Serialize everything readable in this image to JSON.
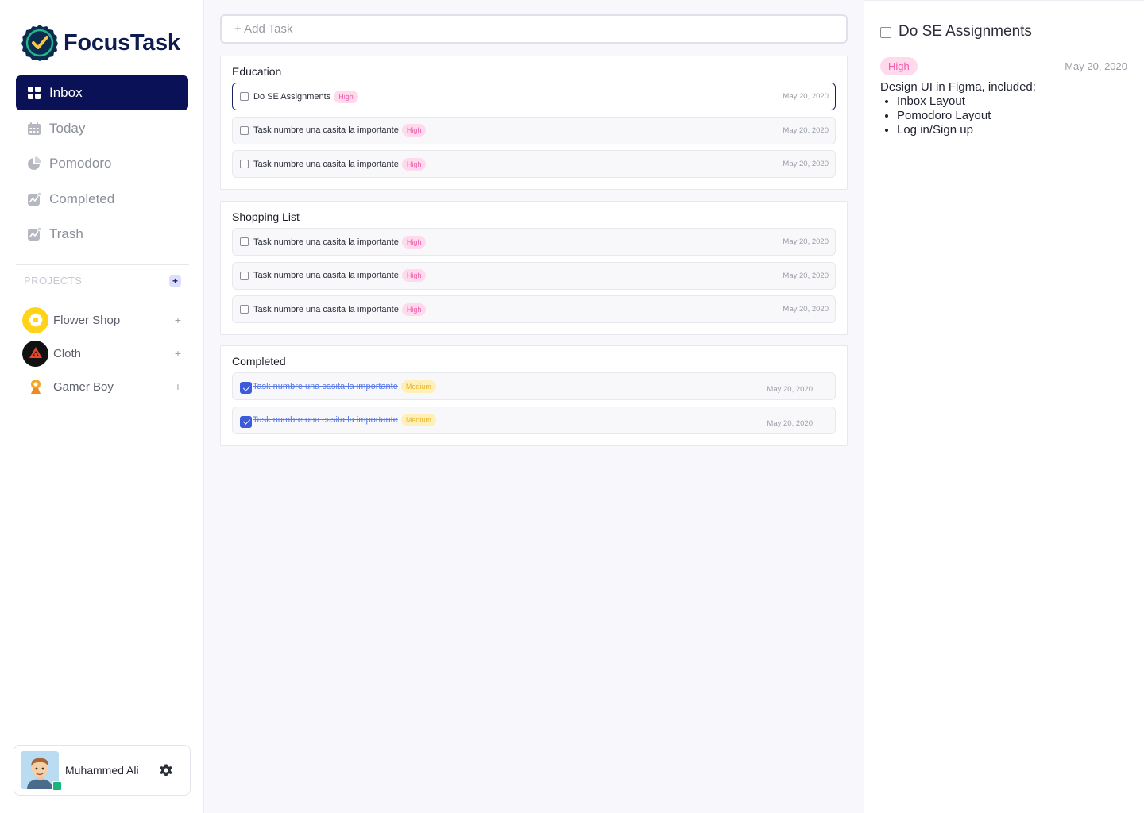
{
  "app": {
    "name": "FocusTask"
  },
  "nav": [
    {
      "label": "Inbox",
      "icon": "grid-icon",
      "active": true
    },
    {
      "label": "Today",
      "icon": "calendar-icon",
      "active": false
    },
    {
      "label": "Pomodoro",
      "icon": "pie-icon",
      "active": false
    },
    {
      "label": "Completed",
      "icon": "chart-icon",
      "active": false
    },
    {
      "label": "Trash",
      "icon": "chart-icon",
      "active": false
    }
  ],
  "projects": {
    "title": "PROJECTS",
    "add_label": "+",
    "items": [
      {
        "name": "Flower Shop",
        "plus": "+",
        "color": "#ffd31a"
      },
      {
        "name": "Cloth",
        "plus": "+",
        "color": "#111111"
      },
      {
        "name": "Gamer Boy",
        "plus": "+",
        "color": "#f5a623"
      }
    ]
  },
  "user": {
    "name": "Muhammed Ali",
    "status_color": "#16b67c"
  },
  "add_task": {
    "placeholder": "+ Add Task"
  },
  "sections": [
    {
      "title": "Education",
      "tasks": [
        {
          "text": "Do SE Assignments",
          "priority": "High",
          "date": "May 20, 2020",
          "done": false,
          "selected": true
        },
        {
          "text": "Task numbre una casita la importante",
          "priority": "High",
          "date": "May 20, 2020",
          "done": false
        },
        {
          "text": "Task numbre una casita la importante",
          "priority": "High",
          "date": "May 20, 2020",
          "done": false
        }
      ]
    },
    {
      "title": "Shopping List",
      "tasks": [
        {
          "text": "Task numbre una casita la importante",
          "priority": "High",
          "date": "May 20, 2020",
          "done": false
        },
        {
          "text": "Task numbre una casita la importante",
          "priority": "High",
          "date": "May 20, 2020",
          "done": false
        },
        {
          "text": "Task numbre una casita la importante",
          "priority": "High",
          "date": "May 20, 2020",
          "done": false
        }
      ]
    },
    {
      "title": "Completed",
      "tasks": [
        {
          "text": "Task numbre una casita la importante",
          "priority": "Medium",
          "date": "May 20, 2020",
          "done": true
        },
        {
          "text": "Task numbre una casita la importante",
          "priority": "Medium",
          "date": "May 20, 2020",
          "done": true
        }
      ]
    }
  ],
  "detail": {
    "title": "Do SE Assignments",
    "priority": "High",
    "date": "May 20, 2020",
    "description": "Design UI in Figma, included:",
    "items": [
      "Inbox Layout",
      "Pomodoro Layout",
      "Log in/Sign up"
    ]
  },
  "colors": {
    "primary": "#0a1157",
    "high_bg": "#ffd9ec",
    "high_fg": "#ee5aa8",
    "medium_bg": "#ffefb8",
    "medium_fg": "#e6b428",
    "check": "#3b5bdb"
  }
}
